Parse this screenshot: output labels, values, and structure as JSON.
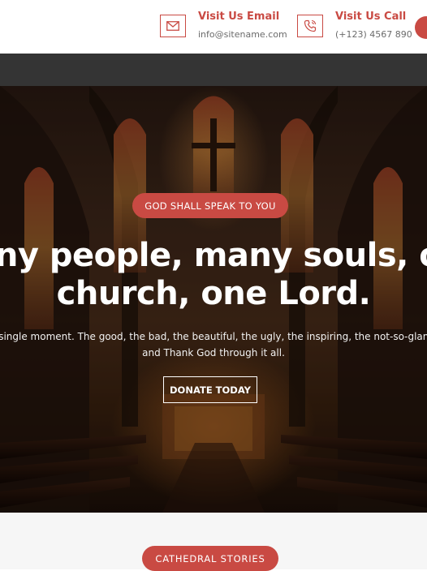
{
  "header": {
    "email": {
      "icon": "mail-icon",
      "title": "Visit Us Email",
      "value": "info@sitename.com"
    },
    "call": {
      "icon": "phone-icon",
      "title": "Visit Us Call",
      "value": "(+123) 4567 890"
    },
    "accent_color": "#c94a43"
  },
  "nav": {
    "background": "#343434"
  },
  "hero": {
    "background_image": "cathedral-interior",
    "badge": "GOD SHALL SPEAK TO YOU",
    "headline_line1": "Many people, many souls, one",
    "headline_line2": "church, one Lord.",
    "subtext_line1": "Every single moment. The good, the bad, the beautiful, the ugly, the inspiring, the not-so-glamorous",
    "subtext_line2": "and Thank God through it all.",
    "cta_label": "DONATE TODAY"
  },
  "section": {
    "badge": "CATHEDRAL STORIES"
  }
}
